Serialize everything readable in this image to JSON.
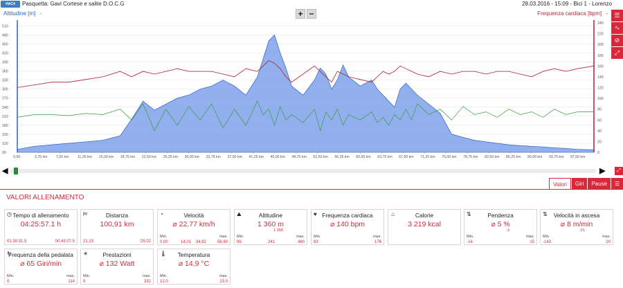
{
  "header": {
    "logo_text": "HAC4",
    "title": "Pasquetta: Gavi Cortese e salite D.O.C.G",
    "meta": "28.03.2016  -  15:09  -  Bici 1  -  Lorenzo"
  },
  "chart_header": {
    "left_label": "Altitudine [m]",
    "left_dropdown": "-",
    "right_label": "Frequenza cardiaca [bpm]",
    "right_dropdown": "-",
    "zoom_in": "+",
    "zoom_out": "−"
  },
  "sidebar": {
    "icons": [
      "list-icon",
      "line-chart-icon",
      "no-symbol-icon",
      "zoom-icon"
    ]
  },
  "colors": {
    "accent": "#d8283a",
    "altitude_fill": "#7ea2ea",
    "altitude_line": "#2f5fd0",
    "heart_rate": "#b01e30",
    "cadence": "#3a9a3a"
  },
  "chart_data": {
    "type": "area",
    "x_unit": "km",
    "x_ticks": [
      "0,00",
      "3,75 km",
      "7,50 km",
      "11,25 km",
      "15,00 km",
      "18,75 km",
      "22,50 km",
      "26,25 km",
      "30,00 km",
      "33,75 km",
      "37,50 km",
      "41,25 km",
      "45,00 km",
      "48,75 km",
      "52,50 km",
      "56,25 km",
      "60,00 km",
      "63,75 km",
      "67,50 km",
      "71,25 km",
      "75,00 km",
      "78,75 km",
      "82,50 km",
      "86,25 km",
      "90,00 km",
      "93,75 km",
      "97,50 km"
    ],
    "y_left_ticks": [
      510,
      480,
      450,
      420,
      390,
      360,
      330,
      300,
      270,
      240,
      210,
      180,
      150,
      120,
      90
    ],
    "y_right_ticks": [
      240,
      220,
      200,
      180,
      160,
      140,
      120,
      100,
      80,
      60,
      40,
      20,
      0
    ],
    "ylim_left": [
      90,
      520
    ],
    "ylim_right": [
      0,
      240
    ],
    "grid": true,
    "x": [
      0,
      3,
      6,
      9,
      12,
      15,
      18,
      20,
      22,
      24,
      26,
      28,
      30,
      32,
      34,
      36,
      38,
      40,
      42,
      43,
      44,
      45,
      46,
      47,
      48,
      50,
      52,
      53,
      54,
      55,
      56,
      57,
      58,
      60,
      62,
      63,
      64,
      65,
      66,
      67,
      68,
      69,
      70,
      72,
      74,
      76,
      78,
      80,
      82,
      84,
      86,
      88,
      90,
      92,
      94,
      96,
      98,
      100.9
    ],
    "series": [
      {
        "name": "Altitudine [m]",
        "values": [
          100,
          110,
          115,
          120,
          125,
          130,
          145,
          200,
          260,
          230,
          250,
          270,
          280,
          300,
          310,
          330,
          310,
          280,
          340,
          400,
          460,
          480,
          420,
          370,
          310,
          280,
          330,
          370,
          350,
          300,
          330,
          380,
          340,
          310,
          330,
          300,
          280,
          260,
          240,
          300,
          320,
          300,
          280,
          250,
          220,
          150,
          140,
          130,
          125,
          120,
          115,
          112,
          110,
          108,
          105,
          103,
          100,
          98
        ]
      },
      {
        "name": "Frequenza cardiaca [bpm]",
        "values": [
          120,
          125,
          130,
          130,
          135,
          140,
          150,
          140,
          150,
          145,
          150,
          155,
          150,
          150,
          150,
          145,
          140,
          155,
          150,
          160,
          170,
          165,
          155,
          140,
          130,
          145,
          160,
          150,
          140,
          130,
          150,
          145,
          140,
          135,
          130,
          140,
          150,
          145,
          150,
          160,
          155,
          150,
          145,
          140,
          150,
          145,
          150,
          150,
          145,
          150,
          150,
          145,
          140,
          150,
          155,
          150,
          155,
          160
        ]
      },
      {
        "name": "Frequenza della pedalata",
        "values": [
          65,
          70,
          70,
          68,
          72,
          70,
          80,
          60,
          90,
          40,
          80,
          50,
          85,
          60,
          90,
          45,
          80,
          50,
          95,
          70,
          80,
          50,
          85,
          60,
          70,
          55,
          80,
          40,
          75,
          60,
          80,
          50,
          70,
          60,
          75,
          55,
          65,
          50,
          70,
          60,
          80,
          60,
          90,
          70,
          80,
          60,
          85,
          70,
          75,
          65,
          80,
          70,
          75,
          65,
          80,
          70,
          75,
          75
        ]
      }
    ]
  },
  "tabs": {
    "valori": "Valori",
    "giri": "Giri",
    "pause": "Pause"
  },
  "section_title": "VALORI ALLENAMENTO",
  "stats": {
    "tempo": {
      "title": "Tempo di allenamento",
      "value": "04:25:57.1 h",
      "left": "01:30:31.5",
      "right": "00:43:07.5"
    },
    "distanza": {
      "title": "Distanza",
      "value": "100,91 km",
      "left": "21,13",
      "right": "25,02"
    },
    "velocita": {
      "title": "Velocità",
      "value": "⌀ 22,77 km/h",
      "min_label": "Min.",
      "min": "0,00",
      "up": "14,01",
      "down": "34,82",
      "max_label": "max.",
      "max": "58,80"
    },
    "altitudine": {
      "title": "Altitudine",
      "value": "1 360 m",
      "sub": "1 358",
      "min_label": "Min.",
      "min": "99",
      "avg": "241",
      "max_label": "max.",
      "max": "480"
    },
    "frequenza": {
      "title": "Frequenza cardiaca",
      "value": "⌀ 140 bpm",
      "min_label": "Min.",
      "min": "83",
      "max_label": "max.",
      "max": "176"
    },
    "calorie": {
      "title": "Calorie",
      "value": "3 219 kcal"
    },
    "pendenza": {
      "title": "Pendenza",
      "value": "⌀ 5 %",
      "sub": "-3",
      "min_label": "Min.",
      "min": "-16",
      "max_label": "max.",
      "max": "15"
    },
    "ascesa": {
      "title": "Velocità in ascesa",
      "value": "⌀ 8 m/min",
      "sub": "-21",
      "min_label": "Min.",
      "min": "-143",
      "max_label": "max.",
      "max": "20"
    },
    "pedalata": {
      "title": "Frequenza della pedalata",
      "value": "⌀ 65 Giri/min",
      "min_label": "Min.",
      "min": "0",
      "max_label": "max.",
      "max": "114"
    },
    "prestazioni": {
      "title": "Prestazioni",
      "value": "⌀ 132 Watt",
      "min_label": "Min.",
      "min": "0",
      "max_label": "max.",
      "max": "332"
    },
    "temperatura": {
      "title": "Temperatura",
      "value": "⌀ 14,9 °C",
      "min_label": "Min.",
      "min": "12,0",
      "max_label": "max.",
      "max": "23,0"
    }
  }
}
